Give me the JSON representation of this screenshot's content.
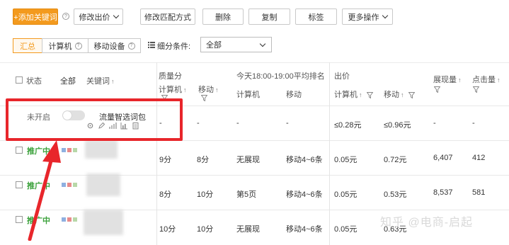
{
  "toolbar": {
    "add_keyword": "+添加关键词",
    "modify_bid": "修改出价",
    "modify_match": "修改匹配方式",
    "delete": "删除",
    "copy": "复制",
    "tag": "标签",
    "more": "更多操作"
  },
  "tabs": {
    "summary": "汇总",
    "computer": "计算机",
    "mobile": "移动设备"
  },
  "filter": {
    "label": "细分条件:",
    "value": "全部"
  },
  "table": {
    "headers": {
      "status": "状态",
      "all": "全部",
      "keyword": "关键词",
      "quality": "质量分",
      "quality_pc": "计算机",
      "quality_mobile": "移动",
      "rank_group": "今天18:00-19:00平均排名",
      "rank_pc": "计算机",
      "rank_mobile": "移动",
      "bid_group": "出价",
      "bid_pc": "计算机",
      "bid_mobile": "移动",
      "impressions": "展现量",
      "clicks": "点击量"
    },
    "special_row": {
      "status": "未开启",
      "name": "流量智选词包",
      "quality_pc": "-",
      "quality_mobile": "-",
      "rank_pc": "-",
      "rank_mobile": "-",
      "bid_pc": "≤0.28元",
      "bid_mobile": "≤0.96元",
      "impressions": "-",
      "clicks": "-"
    },
    "rows": [
      {
        "status": "推广中",
        "quality_pc": "9分",
        "quality_mobile": "8分",
        "rank_pc": "无展现",
        "rank_mobile": "移动4~6条",
        "bid_pc": "0.05元",
        "bid_mobile": "0.72元",
        "impressions": "6,407",
        "clicks": "412"
      },
      {
        "status": "推广中",
        "quality_pc": "8分",
        "quality_mobile": "10分",
        "rank_pc": "第5页",
        "rank_mobile": "移动4~6条",
        "bid_pc": "0.05元",
        "bid_mobile": "0.53元",
        "impressions": "8,537",
        "clicks": "581"
      },
      {
        "status": "推广中",
        "quality_pc": "10分",
        "quality_mobile": "10分",
        "rank_pc": "无展现",
        "rank_mobile": "移动4~6条",
        "bid_pc": "0.05元",
        "bid_mobile": "0.63元",
        "impressions": "",
        "clicks": ""
      }
    ]
  },
  "watermark": "知乎 @电商-启起",
  "colors": {
    "primary": "#f39a1e",
    "status_green": "#3aa13a",
    "highlight_red": "#e8262b"
  }
}
